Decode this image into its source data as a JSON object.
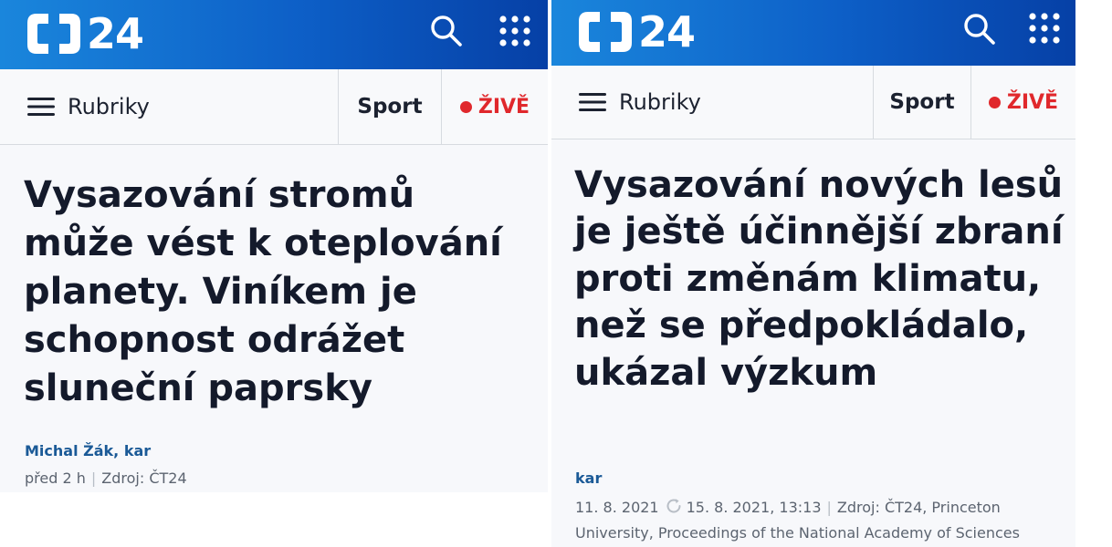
{
  "left": {
    "header": {
      "logo_number": "24"
    },
    "nav": {
      "menu_label": "Rubriky",
      "sport_label": "Sport",
      "live_label": "ŽIVĚ"
    },
    "article": {
      "headline": "Vysazování stromů může vést k oteplování planety. Viníkem je schopnost odrážet sluneční paprsky",
      "authors": "Michal Žák, kar",
      "time": "před 2 h",
      "source": "Zdroj: ČT24"
    }
  },
  "right": {
    "header": {
      "logo_number": "24"
    },
    "nav": {
      "menu_label": "Rubriky",
      "sport_label": "Sport",
      "live_label": "ŽIVĚ"
    },
    "article": {
      "headline": "Vysazování nových lesů je ještě účinnější zbraní proti změnám klimatu, než se předpokládalo, ukázal výzkum",
      "authors": "kar",
      "published": "11. 8. 2021",
      "updated": "15. 8. 2021, 13:13",
      "source": "Zdroj: ČT24, Princeton University, Proceedings of the National Academy of Sciences"
    }
  },
  "colors": {
    "header_blue": "#0d5fc7",
    "live_red": "#e0282c",
    "author_blue": "#1b5a97"
  },
  "icons": [
    "ct-logo-icon",
    "search-icon",
    "apps-grid-icon",
    "hamburger-menu-icon",
    "live-dot-icon",
    "refresh-icon"
  ]
}
